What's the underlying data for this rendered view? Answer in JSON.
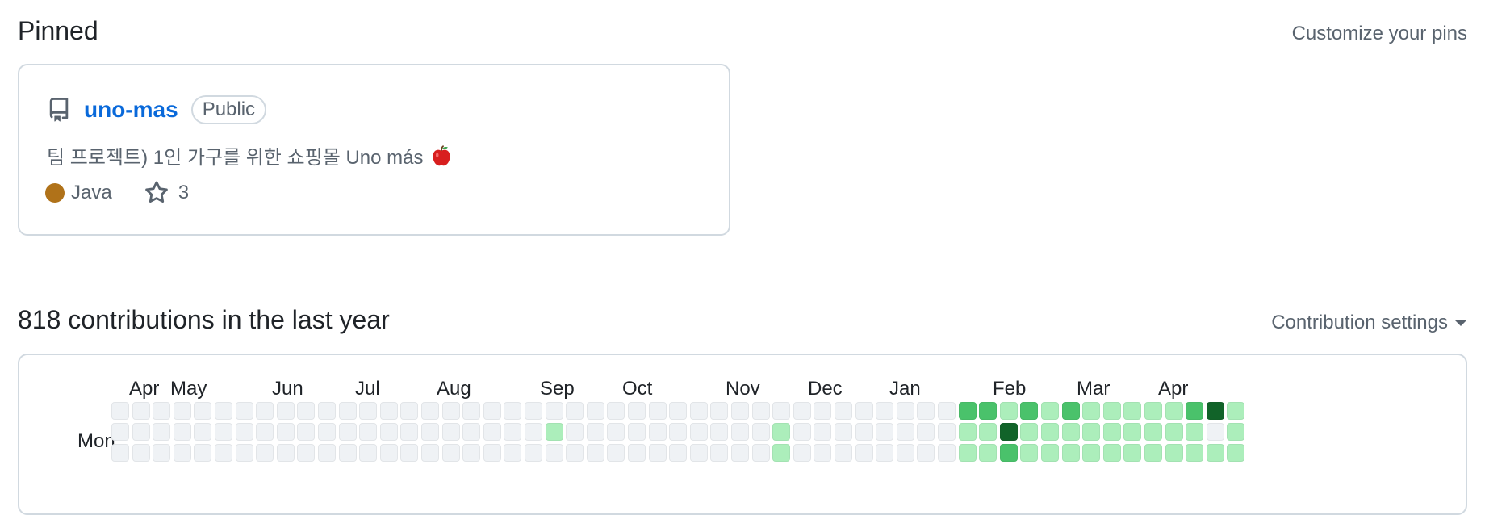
{
  "pinned": {
    "title": "Pinned",
    "customize_label": "Customize your pins",
    "repo": {
      "name": "uno-mas",
      "visibility": "Public",
      "description": "팀 프로젝트) 1인 가구를 위한 쇼핑몰 Uno más",
      "language": "Java",
      "language_color": "#b07219",
      "stars": "3",
      "icon": "repo-icon",
      "emoji_icon": "apple-icon"
    }
  },
  "contributions": {
    "title": "818 contributions in the last year",
    "settings_label": "Contribution settings",
    "months": [
      "Apr",
      "May",
      "Jun",
      "Jul",
      "Aug",
      "Sep",
      "Oct",
      "Nov",
      "Dec",
      "Jan",
      "Feb",
      "Mar",
      "Apr"
    ],
    "day_labels": [
      "Mon"
    ],
    "level_colors": [
      "#eff2f5",
      "#aceebb",
      "#4ac26b",
      "#2da44e",
      "#116329"
    ],
    "levels": [
      [
        0,
        0,
        0,
        0,
        0,
        0,
        0,
        0,
        0,
        0,
        0,
        0,
        0,
        0,
        0,
        0,
        0,
        0,
        0,
        0,
        0,
        0,
        0,
        0,
        0,
        0,
        0,
        0,
        0,
        0,
        0,
        0,
        0,
        0,
        0,
        0,
        0,
        0,
        0,
        0,
        0,
        2,
        2,
        1,
        2,
        1,
        2,
        1,
        1,
        1,
        1,
        1,
        2,
        4,
        1
      ],
      [
        0,
        0,
        0,
        0,
        0,
        0,
        0,
        0,
        0,
        0,
        0,
        0,
        0,
        0,
        0,
        0,
        0,
        0,
        0,
        0,
        0,
        1,
        0,
        0,
        0,
        0,
        0,
        0,
        0,
        0,
        0,
        0,
        1,
        0,
        0,
        0,
        0,
        0,
        0,
        0,
        0,
        1,
        1,
        4,
        1,
        1,
        1,
        1,
        1,
        1,
        1,
        1,
        1,
        0,
        1
      ],
      [
        0,
        0,
        0,
        0,
        0,
        0,
        0,
        0,
        0,
        0,
        0,
        0,
        0,
        0,
        0,
        0,
        0,
        0,
        0,
        0,
        0,
        0,
        0,
        0,
        0,
        0,
        0,
        0,
        0,
        0,
        0,
        0,
        1,
        0,
        0,
        0,
        0,
        0,
        0,
        0,
        0,
        1,
        1,
        2,
        1,
        1,
        1,
        1,
        1,
        1,
        1,
        1,
        1,
        1,
        1
      ]
    ]
  }
}
